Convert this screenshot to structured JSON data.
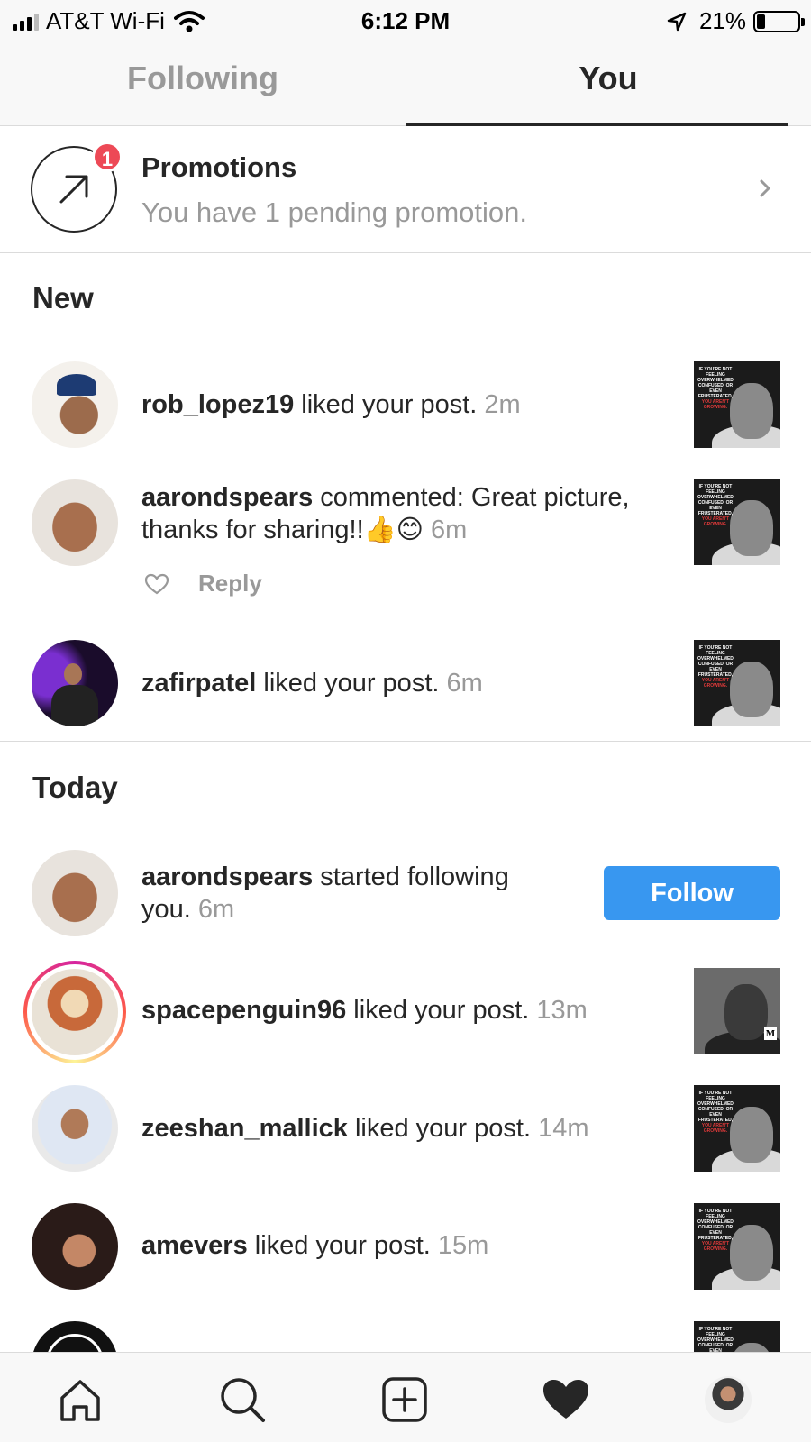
{
  "status_bar": {
    "carrier": "AT&T Wi-Fi",
    "time": "6:12 PM",
    "battery": "21%",
    "battery_level": 0.21
  },
  "tabs": [
    {
      "label": "Following"
    },
    {
      "label": "You"
    }
  ],
  "promotions": {
    "title": "Promotions",
    "subtitle": "You have 1 pending promotion.",
    "badge": "1"
  },
  "sections": {
    "new": "New",
    "today": "Today"
  },
  "notifications": [
    {
      "user": "rob_lopez19",
      "text": " liked your post. ",
      "ago": "2m"
    },
    {
      "user": "aarondspears",
      "text": " commented: Great picture, thanks for sharing!!👍😊 ",
      "ago": "6m",
      "reply_label": "Reply"
    },
    {
      "user": "zafirpatel",
      "text": " liked your post. ",
      "ago": "6m"
    },
    {
      "user": "aarondspears",
      "text": " started following you. ",
      "ago": "6m",
      "button": "Follow"
    },
    {
      "user": "spacepenguin96",
      "text": " liked your post. ",
      "ago": "13m"
    },
    {
      "user": "zeeshan_mallick",
      "text": " liked your post. ",
      "ago": "14m"
    },
    {
      "user": "amevers",
      "text": " liked your post. ",
      "ago": "15m"
    }
  ],
  "thumb_text": {
    "top": "IF YOU'RE NOT FEELING OVERWHELMED, CONFUSED, OR EVEN FRUSTERATED,",
    "red": "YOU AREN'T GROWING."
  },
  "colors": {
    "accent": "#3897f0",
    "badge": "#ed4956",
    "muted": "#999999"
  },
  "nav_icons": [
    "home-icon",
    "search-icon",
    "add-post-icon",
    "heart-icon",
    "profile-avatar"
  ]
}
